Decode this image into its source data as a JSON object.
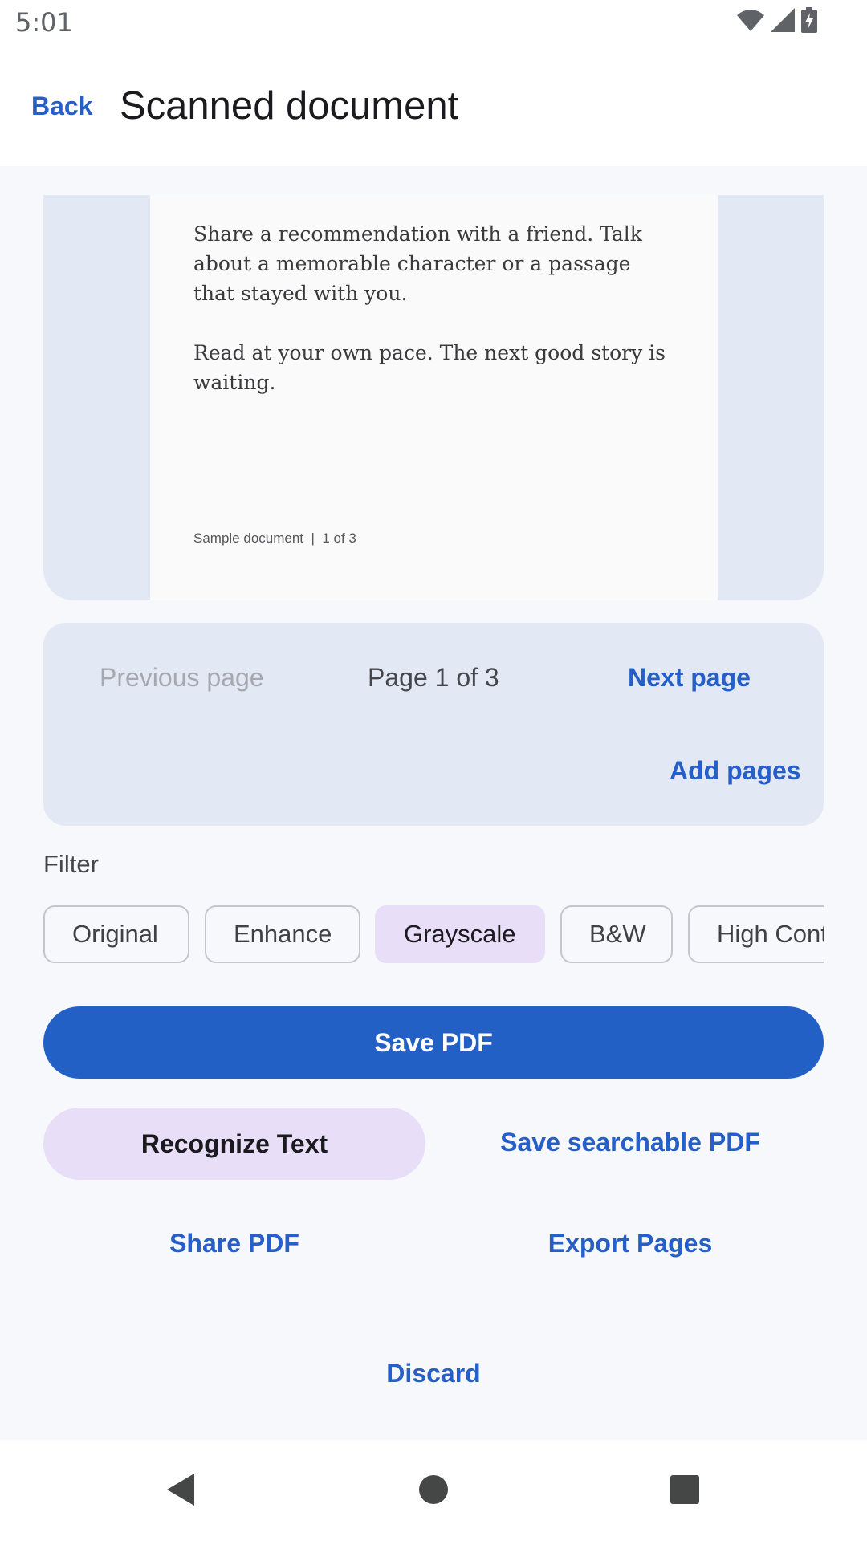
{
  "status_bar": {
    "time": "5:01",
    "icons": [
      "wifi-icon",
      "signal-icon",
      "battery-charging-icon"
    ]
  },
  "app_bar": {
    "back_label": "Back",
    "title": "Scanned document"
  },
  "document": {
    "paragraphs": [
      "Share a recommendation with a friend. Talk about a memorable character or a passage that stayed with you.",
      "Read at your own pace. The next good story is waiting."
    ],
    "footer": "Sample document  |  1 of 3"
  },
  "pager": {
    "previous_label": "Previous page",
    "indicator": "Page 1 of 3",
    "next_label": "Next page",
    "add_pages_label": "Add pages"
  },
  "filter": {
    "label": "Filter",
    "options": [
      "Original",
      "Enhance",
      "Grayscale",
      "B&W",
      "High Contrast"
    ],
    "selected": "Grayscale"
  },
  "actions": {
    "save_pdf": "Save PDF",
    "recognize_text": "Recognize Text",
    "save_searchable_pdf": "Save searchable PDF",
    "share_pdf": "Share PDF",
    "export_pages": "Export Pages",
    "discard": "Discard"
  },
  "nav_bar": {
    "icons": [
      "back-triangle-icon",
      "home-circle-icon",
      "recents-square-icon"
    ]
  },
  "colors": {
    "accent": "#2360c6",
    "tonal": "#e8def7",
    "surface_variant": "#e3e9f4"
  }
}
